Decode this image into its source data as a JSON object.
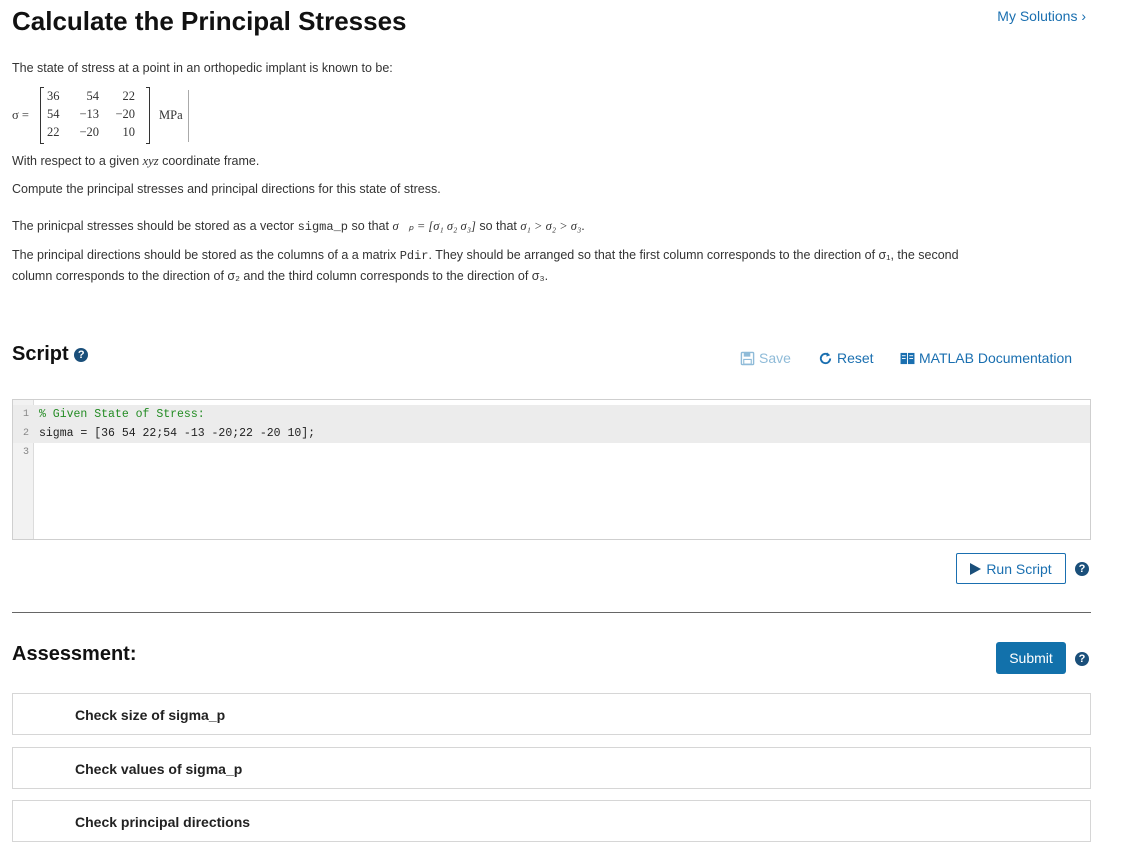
{
  "header": {
    "title": "Calculate the Principal Stresses",
    "my_solutions": "My Solutions ›"
  },
  "problem": {
    "intro": "The state of stress at a point in an orthopedic implant is known to be:",
    "sigma_label": "σ =",
    "matrix": [
      [
        "36",
        "54",
        "22"
      ],
      [
        "54",
        "−13",
        "−20"
      ],
      [
        "22",
        "−20",
        "10"
      ]
    ],
    "unit": "MPa",
    "frame_pre": "With respect to a given ",
    "frame_math": "xyz",
    "frame_post": " coordinate frame.",
    "compute": "Compute the principal stresses and principal directions for this state of stress.",
    "vector_pre": "The prinicpal stresses should be stored as a vector ",
    "vector_var": "sigma_p",
    "vector_mid": " so that ",
    "vector_math": "σ⃗ₚ = [σ₁  σ₂  σ₃]",
    "vector_post": " so that ",
    "vector_order": "σ₁ > σ₂ > σ₃",
    "vector_end": ".",
    "dir_pre": "The principal directions should be stored as the columns of a a matrix ",
    "dir_var": "Pdir",
    "dir_line1_post": ". They should be arranged so that the first column corresponds to the direction of σ₁, the second",
    "dir_line2": "column corresponds to the direction of σ₂ and the third column corresponds to the direction of σ₃."
  },
  "script": {
    "title": "Script",
    "help": "?",
    "save_label": "Save",
    "reset_label": "Reset",
    "docs_label": "MATLAB Documentation",
    "lines": [
      {
        "num": "1",
        "text": "% Given State of Stress:"
      },
      {
        "num": "2",
        "text": "sigma = [36 54 22;54 -13 -20;22 -20 10];"
      },
      {
        "num": "3",
        "text": ""
      }
    ],
    "run_label": "Run Script"
  },
  "assessment": {
    "title": "Assessment:",
    "submit_label": "Submit",
    "help": "?",
    "items": [
      {
        "label": "Check size of sigma_p"
      },
      {
        "label": "Check values of sigma_p"
      },
      {
        "label": "Check principal directions"
      }
    ]
  },
  "colors": {
    "link": "#1a6fb0",
    "submit": "#1271ab",
    "comment": "#228b22"
  },
  "icons": [
    "save-icon",
    "reset-icon",
    "documentation-icon",
    "play-icon",
    "help-icon"
  ]
}
